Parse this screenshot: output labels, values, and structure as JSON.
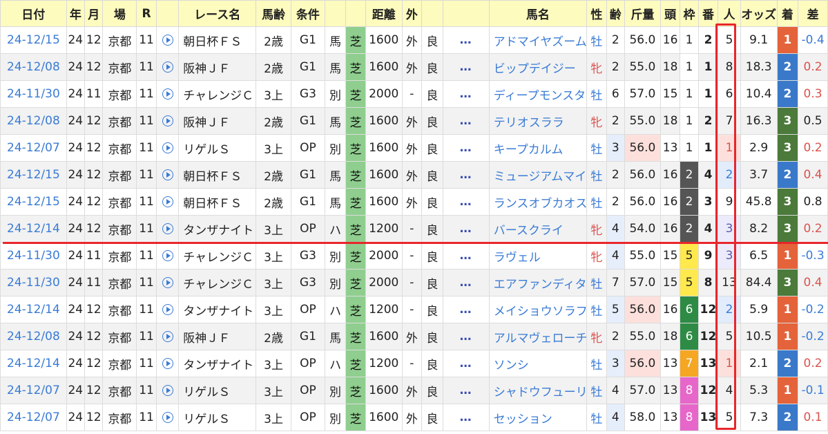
{
  "headers": [
    "日付",
    "年",
    "月",
    "場",
    "R",
    "",
    "レース名",
    "馬齢",
    "条件",
    "",
    "",
    "距離",
    "外",
    "",
    "",
    "馬名",
    "性",
    "齢",
    "斤量",
    "頭",
    "枠",
    "番",
    "人",
    "オッズ",
    "着",
    "差"
  ],
  "rows": [
    {
      "date": "24-12/15",
      "year": "24",
      "month": "12",
      "place": "京都",
      "r": "11",
      "race": "朝日杯ＦＳ",
      "age_cond": "2歳",
      "grade": "G1",
      "cond2": "馬",
      "surface": "芝",
      "dist": "1600",
      "inout": "外",
      "track": "良",
      "more": "…",
      "horse": "アドマイヤズーム",
      "sex": "牡",
      "age": "2",
      "weight": "56.0",
      "heads": "16",
      "waku": "1",
      "ban": "2",
      "ninki": "5",
      "odds": "9.1",
      "chaku": "1",
      "sa": "-0.4"
    },
    {
      "date": "24-12/08",
      "year": "24",
      "month": "12",
      "place": "京都",
      "r": "11",
      "race": "阪神ＪＦ",
      "age_cond": "2歳",
      "grade": "G1",
      "cond2": "馬",
      "surface": "芝",
      "dist": "1600",
      "inout": "外",
      "track": "良",
      "more": "…",
      "horse": "ビップデイジー",
      "sex": "牝",
      "age": "2",
      "weight": "55.0",
      "heads": "18",
      "waku": "1",
      "ban": "1",
      "ninki": "8",
      "odds": "18.3",
      "chaku": "2",
      "sa": "0.2"
    },
    {
      "date": "24-11/30",
      "year": "24",
      "month": "11",
      "place": "京都",
      "r": "11",
      "race": "チャレンジＣ",
      "age_cond": "3上",
      "grade": "G3",
      "cond2": "別",
      "surface": "芝",
      "dist": "2000",
      "inout": "-",
      "track": "良",
      "more": "…",
      "horse": "ディープモンスター",
      "sex": "牡",
      "age": "6",
      "weight": "57.0",
      "heads": "15",
      "waku": "1",
      "ban": "1",
      "ninki": "6",
      "odds": "10.4",
      "chaku": "2",
      "sa": "0.3"
    },
    {
      "date": "24-12/08",
      "year": "24",
      "month": "12",
      "place": "京都",
      "r": "11",
      "race": "阪神ＪＦ",
      "age_cond": "2歳",
      "grade": "G1",
      "cond2": "馬",
      "surface": "芝",
      "dist": "1600",
      "inout": "外",
      "track": "良",
      "more": "…",
      "horse": "テリオスララ",
      "sex": "牝",
      "age": "2",
      "weight": "55.0",
      "heads": "18",
      "waku": "1",
      "ban": "2",
      "ninki": "7",
      "odds": "16.3",
      "chaku": "3",
      "sa": "0.5"
    },
    {
      "date": "24-12/07",
      "year": "24",
      "month": "12",
      "place": "京都",
      "r": "11",
      "race": "リゲルＳ",
      "age_cond": "3上",
      "grade": "OP",
      "cond2": "別",
      "surface": "芝",
      "dist": "1600",
      "inout": "外",
      "track": "良",
      "more": "…",
      "horse": "キープカルム",
      "sex": "牡",
      "age": "3",
      "weight": "56.0",
      "heads": "13",
      "waku": "1",
      "ban": "1",
      "ninki": "1",
      "odds": "2.9",
      "chaku": "3",
      "sa": "0.2"
    },
    {
      "date": "24-12/15",
      "year": "24",
      "month": "12",
      "place": "京都",
      "r": "11",
      "race": "朝日杯ＦＳ",
      "age_cond": "2歳",
      "grade": "G1",
      "cond2": "馬",
      "surface": "芝",
      "dist": "1600",
      "inout": "外",
      "track": "良",
      "more": "…",
      "horse": "ミュージアムマイル",
      "sex": "牡",
      "age": "2",
      "weight": "56.0",
      "heads": "16",
      "waku": "2",
      "ban": "4",
      "ninki": "2",
      "odds": "3.7",
      "chaku": "2",
      "sa": "0.4"
    },
    {
      "date": "24-12/15",
      "year": "24",
      "month": "12",
      "place": "京都",
      "r": "11",
      "race": "朝日杯ＦＳ",
      "age_cond": "2歳",
      "grade": "G1",
      "cond2": "馬",
      "surface": "芝",
      "dist": "1600",
      "inout": "外",
      "track": "良",
      "more": "…",
      "horse": "ランスオブカオス",
      "sex": "牡",
      "age": "2",
      "weight": "56.0",
      "heads": "16",
      "waku": "2",
      "ban": "3",
      "ninki": "9",
      "odds": "45.8",
      "chaku": "3",
      "sa": "0.8"
    },
    {
      "date": "24-12/14",
      "year": "24",
      "month": "12",
      "place": "京都",
      "r": "11",
      "race": "タンザナイト",
      "age_cond": "3上",
      "grade": "OP",
      "cond2": "ハ",
      "surface": "芝",
      "dist": "1200",
      "inout": "-",
      "track": "良",
      "more": "…",
      "horse": "バースクライ",
      "sex": "牝",
      "age": "4",
      "weight": "54.0",
      "heads": "16",
      "waku": "2",
      "ban": "4",
      "ninki": "3",
      "odds": "8.2",
      "chaku": "3",
      "sa": "0.2"
    },
    {
      "date": "24-11/30",
      "year": "24",
      "month": "11",
      "place": "京都",
      "r": "11",
      "race": "チャレンジＣ",
      "age_cond": "3上",
      "grade": "G3",
      "cond2": "別",
      "surface": "芝",
      "dist": "2000",
      "inout": "-",
      "track": "良",
      "more": "…",
      "horse": "ラヴェル",
      "sex": "牝",
      "age": "4",
      "weight": "55.0",
      "heads": "15",
      "waku": "5",
      "ban": "9",
      "ninki": "3",
      "odds": "6.5",
      "chaku": "1",
      "sa": "-0.3"
    },
    {
      "date": "24-11/30",
      "year": "24",
      "month": "11",
      "place": "京都",
      "r": "11",
      "race": "チャレンジＣ",
      "age_cond": "3上",
      "grade": "G3",
      "cond2": "別",
      "surface": "芝",
      "dist": "2000",
      "inout": "-",
      "track": "良",
      "more": "…",
      "horse": "エアファンディタ",
      "sex": "牡",
      "age": "7",
      "weight": "57.0",
      "heads": "15",
      "waku": "5",
      "ban": "8",
      "ninki": "13",
      "odds": "84.4",
      "chaku": "3",
      "sa": "0.4"
    },
    {
      "date": "24-12/14",
      "year": "24",
      "month": "12",
      "place": "京都",
      "r": "11",
      "race": "タンザナイト",
      "age_cond": "3上",
      "grade": "OP",
      "cond2": "ハ",
      "surface": "芝",
      "dist": "1200",
      "inout": "-",
      "track": "良",
      "more": "…",
      "horse": "メイショウソラフネ",
      "sex": "牡",
      "age": "5",
      "weight": "56.0",
      "heads": "16",
      "waku": "6",
      "ban": "12",
      "ninki": "2",
      "odds": "5.9",
      "chaku": "1",
      "sa": "-0.2"
    },
    {
      "date": "24-12/08",
      "year": "24",
      "month": "12",
      "place": "京都",
      "r": "11",
      "race": "阪神ＪＦ",
      "age_cond": "2歳",
      "grade": "G1",
      "cond2": "馬",
      "surface": "芝",
      "dist": "1600",
      "inout": "外",
      "track": "良",
      "more": "…",
      "horse": "アルマヴェローチェ",
      "sex": "牝",
      "age": "2",
      "weight": "55.0",
      "heads": "18",
      "waku": "6",
      "ban": "12",
      "ninki": "5",
      "odds": "10.5",
      "chaku": "1",
      "sa": "-0.2"
    },
    {
      "date": "24-12/14",
      "year": "24",
      "month": "12",
      "place": "京都",
      "r": "11",
      "race": "タンザナイト",
      "age_cond": "3上",
      "grade": "OP",
      "cond2": "ハ",
      "surface": "芝",
      "dist": "1200",
      "inout": "-",
      "track": "良",
      "more": "…",
      "horse": "ソンシ",
      "sex": "牡",
      "age": "3",
      "weight": "56.0",
      "heads": "13",
      "waku": "7",
      "ban": "13",
      "ninki": "1",
      "odds": "2.1",
      "chaku": "2",
      "sa": "0.2"
    },
    {
      "date": "24-12/07",
      "year": "24",
      "month": "12",
      "place": "京都",
      "r": "11",
      "race": "リゲルＳ",
      "age_cond": "3上",
      "grade": "OP",
      "cond2": "別",
      "surface": "芝",
      "dist": "1600",
      "inout": "外",
      "track": "良",
      "more": "…",
      "horse": "シャドウフューリー",
      "sex": "牡",
      "age": "4",
      "weight": "57.0",
      "heads": "13",
      "waku": "8",
      "ban": "12",
      "ninki": "4",
      "odds": "5.3",
      "chaku": "1",
      "sa": "-0.1"
    },
    {
      "date": "24-12/07",
      "year": "24",
      "month": "12",
      "place": "京都",
      "r": "11",
      "race": "リゲルＳ",
      "age_cond": "3上",
      "grade": "OP",
      "cond2": "別",
      "surface": "芝",
      "dist": "1600",
      "inout": "外",
      "track": "良",
      "more": "…",
      "horse": "セッション",
      "sex": "牡",
      "age": "4",
      "weight": "58.0",
      "heads": "13",
      "waku": "8",
      "ban": "13",
      "ninki": "5",
      "odds": "7.3",
      "chaku": "2",
      "sa": "0.1"
    }
  ],
  "colors": {
    "header_bg": "#fdfbbe",
    "link_blue": "#3a7bd5",
    "red": "#d9534f",
    "surface_turf": "#8fce8f",
    "highlight_red": "#e8262c"
  }
}
